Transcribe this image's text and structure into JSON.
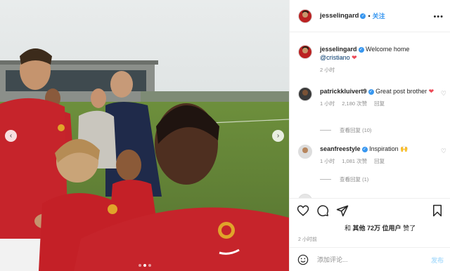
{
  "post": {
    "username": "jesselingard",
    "follow_separator": "•",
    "follow_label": "关注",
    "more_icon": "more-dots-icon"
  },
  "carousel": {
    "prev_icon": "‹",
    "next_icon": "›",
    "slide_count": 3,
    "active_slide": 2
  },
  "caption": {
    "username": "jesselingard",
    "text": "Welcome home",
    "mention": "@cristiano",
    "emoji": "❤",
    "time": "2 小时"
  },
  "comments": [
    {
      "username": "patrickkluivert9",
      "text": "Great post brother",
      "emoji": "❤",
      "time": "1 小时",
      "likes": "2,180 次赞",
      "reply_label": "回复",
      "view_replies": "查看回复 (10)"
    },
    {
      "username": "seanfreestyle",
      "text": "Inspiration",
      "emoji": "🙌",
      "time": "1 小时",
      "likes": "1,081 次赞",
      "reply_label": "回复",
      "view_replies": "查看回复 (1)"
    }
  ],
  "likes": {
    "prefix": "和",
    "count": "其他 72万 位用户",
    "suffix": "赞了"
  },
  "timestamp": "2 小时前",
  "comment_box": {
    "placeholder": "添加评论...",
    "post_label": "发布"
  },
  "colors": {
    "accent": "#3897f0",
    "heart": "#ed4956",
    "muted": "#8e8e8e"
  }
}
